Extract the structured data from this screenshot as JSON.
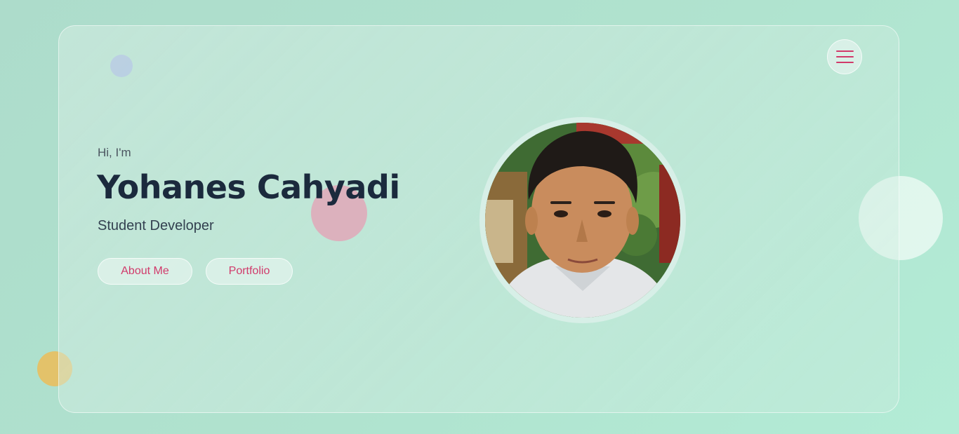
{
  "hero": {
    "greeting": "Hi, I'm",
    "name": "Yohanes Cahyadi",
    "role": "Student Developer"
  },
  "buttons": {
    "about_label": "About Me",
    "portfolio_label": "Portfolio"
  },
  "menu": {
    "icon": "hamburger-menu-icon"
  },
  "colors": {
    "accent": "#d13a6b",
    "heading": "#1b2a3d",
    "background": "#b0e3cf"
  }
}
